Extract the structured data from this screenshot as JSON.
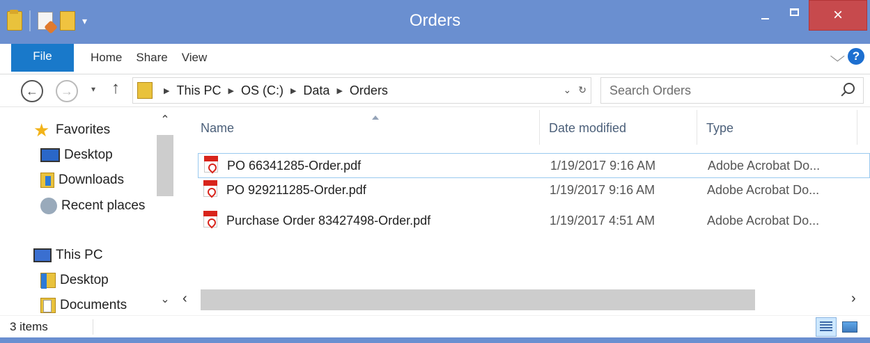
{
  "window": {
    "title": "Orders",
    "close_glyph": "×"
  },
  "ribbon": {
    "file_tab": "File",
    "tabs": [
      "Home",
      "Share",
      "View"
    ],
    "help_glyph": "?",
    "expand_glyph": "⌵"
  },
  "nav": {
    "back_glyph": "←",
    "forward_glyph": "→",
    "recent_glyph": "▾",
    "up_glyph": "↑"
  },
  "address": {
    "crumbs": [
      "This PC",
      "OS (C:)",
      "Data",
      "Orders"
    ],
    "dropdown_glyph": "⌄",
    "refresh_glyph": "↻"
  },
  "search": {
    "placeholder": "Search Orders"
  },
  "sidebar": {
    "items": [
      {
        "label": "Favorites",
        "icon": "star-icon"
      },
      {
        "label": "Desktop",
        "icon": "desktop-icon"
      },
      {
        "label": "Downloads",
        "icon": "downloads-icon"
      },
      {
        "label": "Recent places",
        "icon": "recent-places-icon"
      },
      {
        "label": "This PC",
        "icon": "this-pc-icon"
      },
      {
        "label": "Desktop",
        "icon": "folder-icon"
      },
      {
        "label": "Documents",
        "icon": "documents-icon"
      }
    ],
    "scroll_up_glyph": "⌃",
    "scroll_down_glyph": "⌄"
  },
  "columns": {
    "name": "Name",
    "date": "Date modified",
    "type": "Type"
  },
  "files": [
    {
      "name": "PO 66341285-Order.pdf",
      "date": "1/19/2017 9:16 AM",
      "type": "Adobe Acrobat Do...",
      "selected": true
    },
    {
      "name": "PO 929211285-Order.pdf",
      "date": "1/19/2017 9:16 AM",
      "type": "Adobe Acrobat Do...",
      "selected": false
    },
    {
      "name": "Purchase Order 83427498-Order.pdf",
      "date": "1/19/2017 4:51 AM",
      "type": "Adobe Acrobat Do...",
      "selected": false
    }
  ],
  "hscroll": {
    "left_glyph": "‹",
    "right_glyph": "›"
  },
  "status": {
    "count": "3 items"
  },
  "colors": {
    "titlebar": "#6a8fd0",
    "file_tab": "#1979ca",
    "close_button": "#c74a4d",
    "selection_border": "#99c9ef"
  }
}
